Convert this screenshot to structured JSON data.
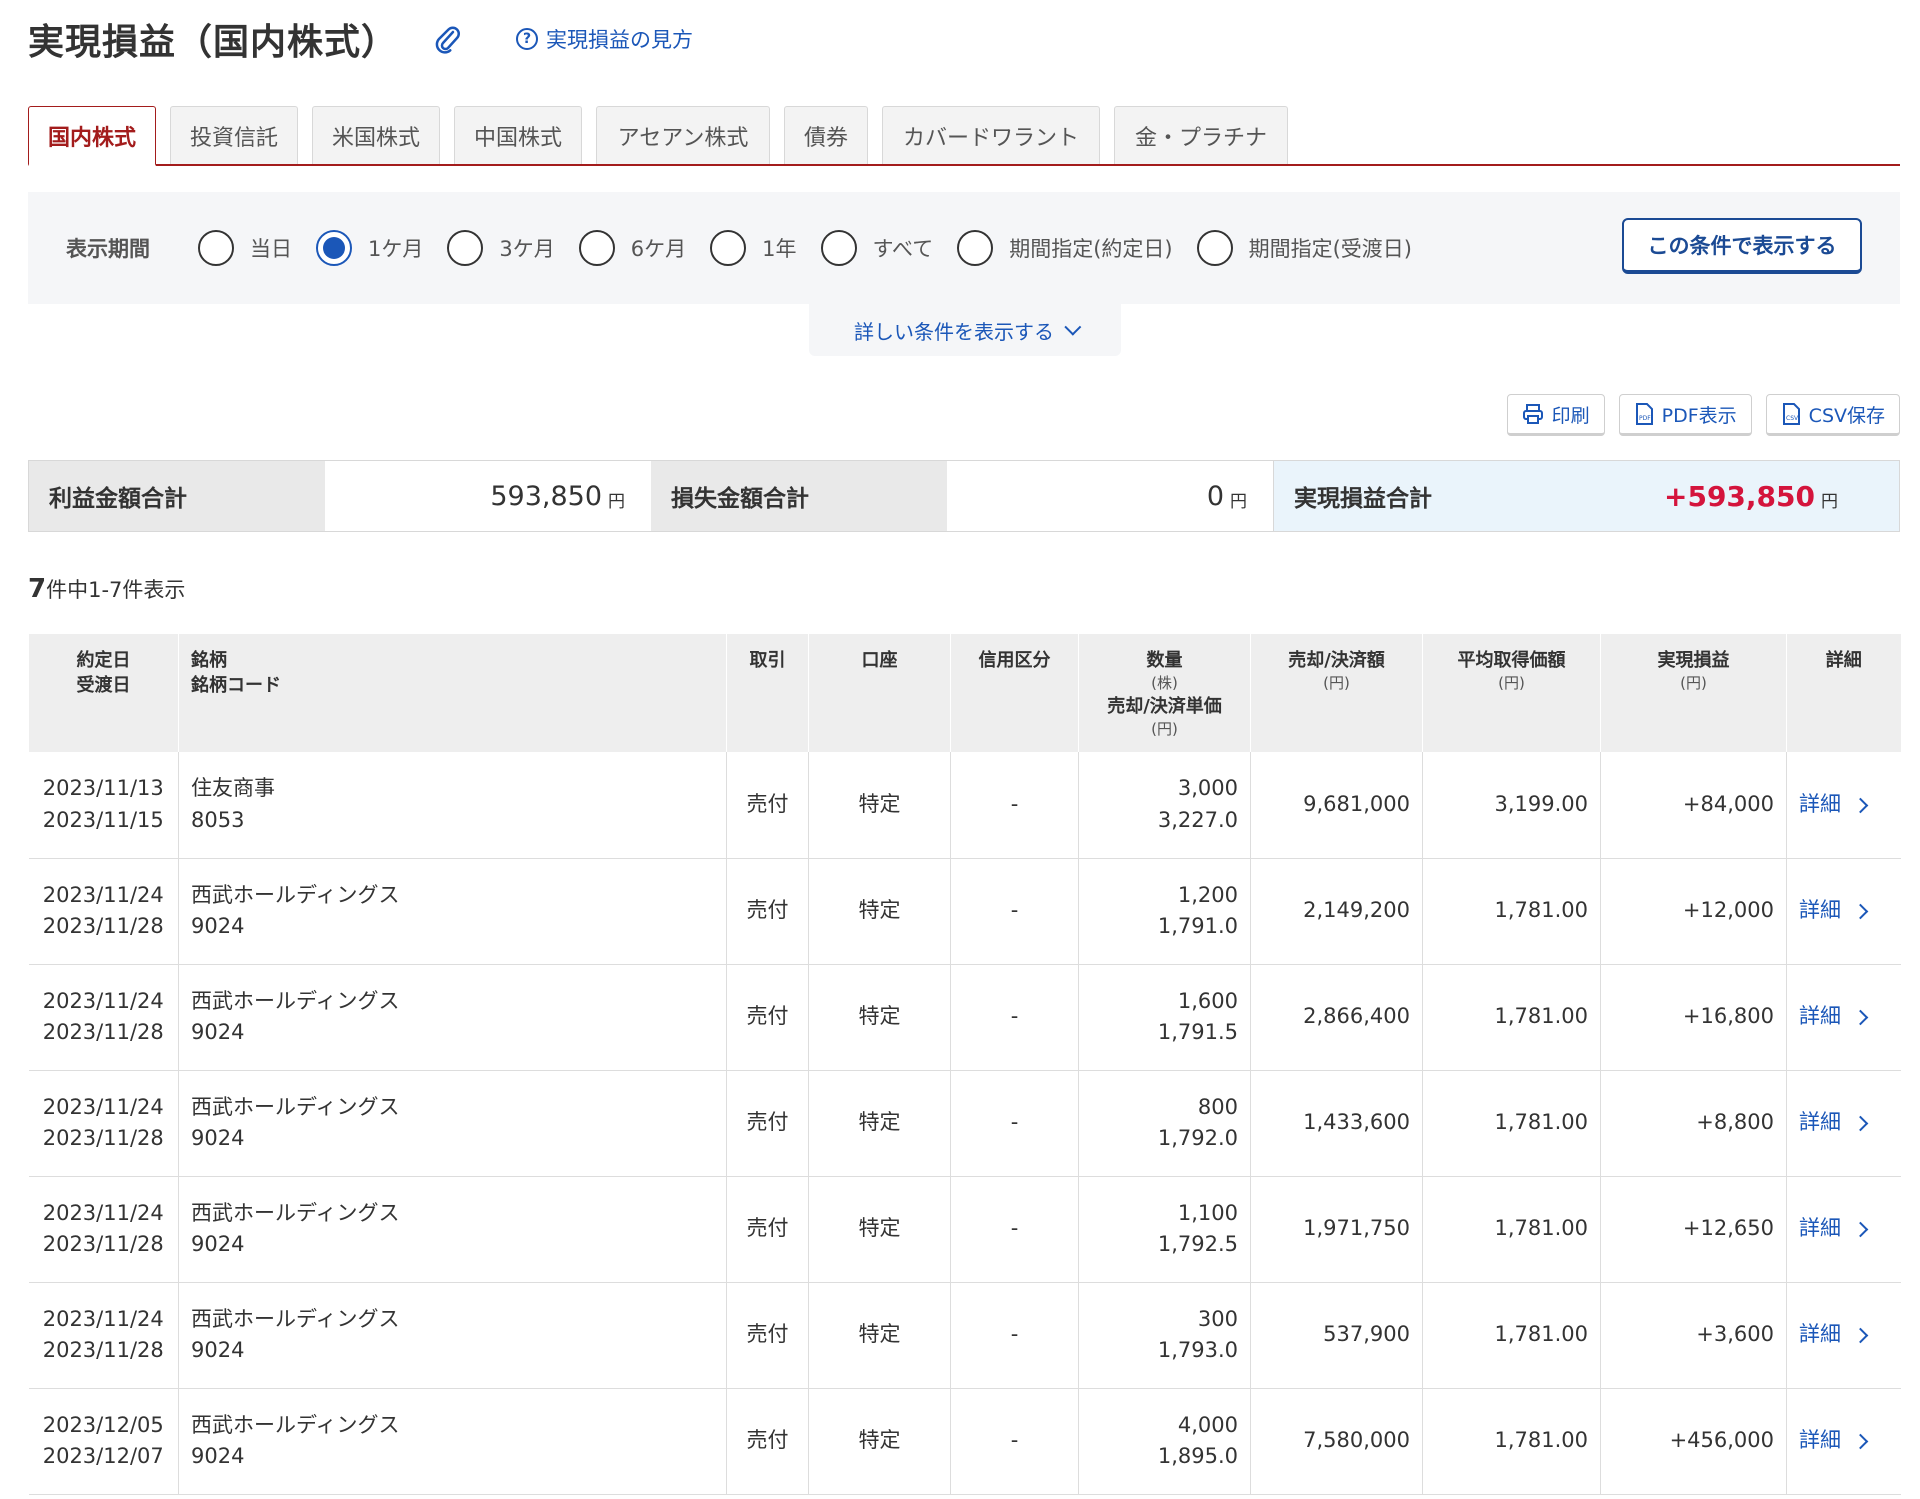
{
  "header": {
    "title": "実現損益（国内株式）",
    "help_link": "実現損益の見方"
  },
  "tabs": [
    {
      "label": "国内株式",
      "active": true
    },
    {
      "label": "投資信託"
    },
    {
      "label": "米国株式"
    },
    {
      "label": "中国株式"
    },
    {
      "label": "アセアン株式"
    },
    {
      "label": "債券"
    },
    {
      "label": "カバードワラント"
    },
    {
      "label": "金・プラチナ"
    }
  ],
  "filter": {
    "label": "表示期間",
    "options": [
      "当日",
      "1ケ月",
      "3ケ月",
      "6ケ月",
      "1年",
      "すべて",
      "期間指定(約定日)",
      "期間指定(受渡日)"
    ],
    "selected": "1ケ月",
    "submit_label": "この条件で表示する",
    "more_label": "詳しい条件を表示する"
  },
  "actions": {
    "print": "印刷",
    "pdf": "PDF表示",
    "csv": "CSV保存"
  },
  "summary": {
    "profit_label": "利益金額合計",
    "profit_value": "593,850",
    "loss_label": "損失金額合計",
    "loss_value": "0",
    "total_label": "実現損益合計",
    "total_value": "+593,850",
    "unit": "円"
  },
  "count": {
    "total": "7",
    "text": "件中1-7件表示"
  },
  "table": {
    "headers": {
      "date1": "約定日",
      "date2": "受渡日",
      "name1": "銘柄",
      "name2": "銘柄コード",
      "trade": "取引",
      "account": "口座",
      "credit": "信用区分",
      "qty": "数量",
      "qty_unit": "(株)",
      "price": "売却/決済単価",
      "price_unit": "(円)",
      "amount": "売却/決済額",
      "amount_unit": "(円)",
      "avg": "平均取得価額",
      "avg_unit": "(円)",
      "pl": "実現損益",
      "pl_unit": "(円)",
      "detail": "詳細"
    },
    "rows": [
      {
        "trade_date": "2023/11/13",
        "settle_date": "2023/11/15",
        "name": "住友商事",
        "code": "8053",
        "trade": "売付",
        "account": "特定",
        "credit": "-",
        "qty": "3,000",
        "price": "3,227.0",
        "amount": "9,681,000",
        "avg": "3,199.00",
        "pl": "+84,000",
        "detail": "詳細"
      },
      {
        "trade_date": "2023/11/24",
        "settle_date": "2023/11/28",
        "name": "西武ホールディングス",
        "code": "9024",
        "trade": "売付",
        "account": "特定",
        "credit": "-",
        "qty": "1,200",
        "price": "1,791.0",
        "amount": "2,149,200",
        "avg": "1,781.00",
        "pl": "+12,000",
        "detail": "詳細"
      },
      {
        "trade_date": "2023/11/24",
        "settle_date": "2023/11/28",
        "name": "西武ホールディングス",
        "code": "9024",
        "trade": "売付",
        "account": "特定",
        "credit": "-",
        "qty": "1,600",
        "price": "1,791.5",
        "amount": "2,866,400",
        "avg": "1,781.00",
        "pl": "+16,800",
        "detail": "詳細"
      },
      {
        "trade_date": "2023/11/24",
        "settle_date": "2023/11/28",
        "name": "西武ホールディングス",
        "code": "9024",
        "trade": "売付",
        "account": "特定",
        "credit": "-",
        "qty": "800",
        "price": "1,792.0",
        "amount": "1,433,600",
        "avg": "1,781.00",
        "pl": "+8,800",
        "detail": "詳細"
      },
      {
        "trade_date": "2023/11/24",
        "settle_date": "2023/11/28",
        "name": "西武ホールディングス",
        "code": "9024",
        "trade": "売付",
        "account": "特定",
        "credit": "-",
        "qty": "1,100",
        "price": "1,792.5",
        "amount": "1,971,750",
        "avg": "1,781.00",
        "pl": "+12,650",
        "detail": "詳細"
      },
      {
        "trade_date": "2023/11/24",
        "settle_date": "2023/11/28",
        "name": "西武ホールディングス",
        "code": "9024",
        "trade": "売付",
        "account": "特定",
        "credit": "-",
        "qty": "300",
        "price": "1,793.0",
        "amount": "537,900",
        "avg": "1,781.00",
        "pl": "+3,600",
        "detail": "詳細"
      },
      {
        "trade_date": "2023/12/05",
        "settle_date": "2023/12/07",
        "name": "西武ホールディングス",
        "code": "9024",
        "trade": "売付",
        "account": "特定",
        "credit": "-",
        "qty": "4,000",
        "price": "1,895.0",
        "amount": "7,580,000",
        "avg": "1,781.00",
        "pl": "+456,000",
        "detail": "詳細"
      }
    ]
  },
  "colors": {
    "accent_red": "#a31c1c",
    "profit_red": "#d4143c",
    "link_blue": "#1b57b8"
  }
}
